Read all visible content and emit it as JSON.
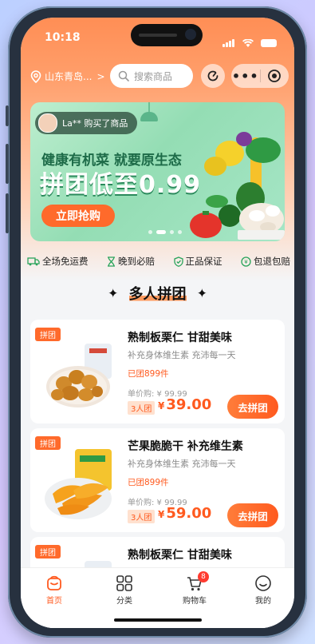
{
  "status": {
    "time": "10:18"
  },
  "nav": {
    "location": "山东青岛...",
    "location_chevron": ">",
    "search_placeholder": "搜索商品"
  },
  "banner": {
    "buyer": "La** 购买了商品",
    "line1": "健康有机菜 就要原生态",
    "line2": "拼团低至0.99",
    "cta": "立即抢购"
  },
  "guarantees": [
    "全场免运费",
    "晚到必赔",
    "正品保证",
    "包退包赔"
  ],
  "section": {
    "title": "多人拼团",
    "star": "✦"
  },
  "products": [
    {
      "tag": "拼团",
      "title": "熟制板栗仁 甘甜美味",
      "subtitle": "补充身体维生素 充沛每一天",
      "joined": "已团899件",
      "single_price": "单价购: ¥ 99.99",
      "group_size": "3人团",
      "currency": "¥",
      "price": "39.00",
      "button": "去拼团"
    },
    {
      "tag": "拼团",
      "title": "芒果脆脆干 补充维生素",
      "subtitle": "补充身体维生素 充沛每一天",
      "joined": "已团899件",
      "single_price": "单价购: ¥ 99.99",
      "group_size": "3人团",
      "currency": "¥",
      "price": "59.00",
      "button": "去拼团"
    },
    {
      "tag": "拼团",
      "title": "熟制板栗仁 甘甜美味"
    }
  ],
  "tabbar": {
    "home": "首页",
    "category": "分类",
    "cart": "购物车",
    "cart_badge": "8",
    "mine": "我的"
  },
  "colors": {
    "brand": "#ff6a2b",
    "price": "#ff5a1f",
    "header": "#ff8e55"
  }
}
